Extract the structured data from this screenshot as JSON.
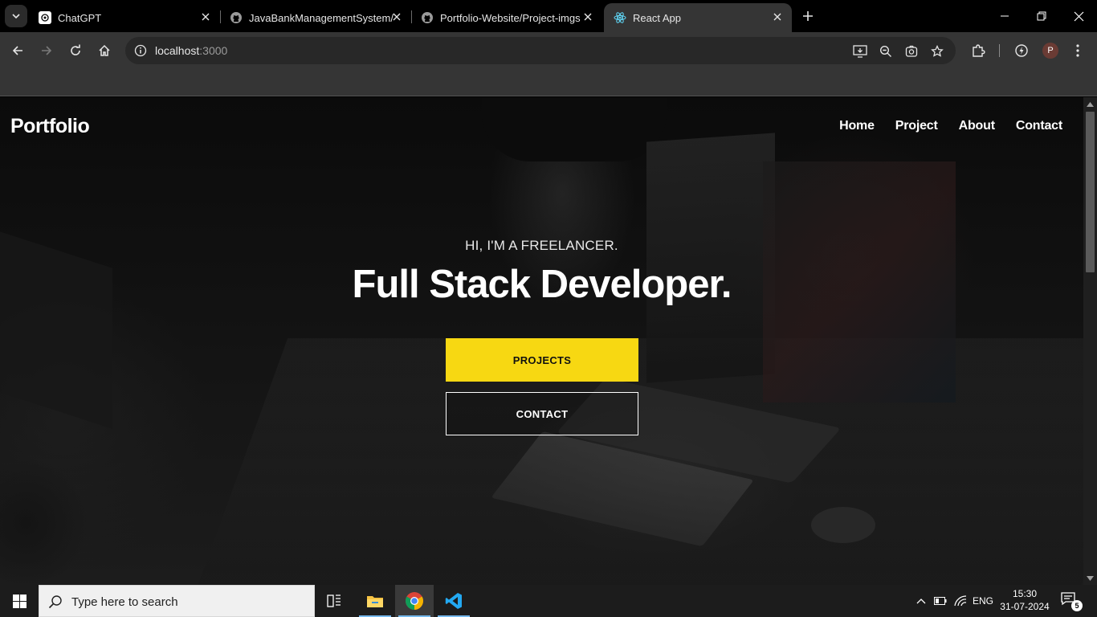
{
  "browser": {
    "tabs": [
      {
        "title": "ChatGPT",
        "favicon": "chatgpt-icon",
        "active": false
      },
      {
        "title": "JavaBankManagementSystem/R",
        "favicon": "github-icon",
        "active": false
      },
      {
        "title": "Portfolio-Website/Project-imgs",
        "favicon": "github-icon",
        "active": false
      },
      {
        "title": "React App",
        "favicon": "react-icon",
        "active": true
      }
    ],
    "url_host": "localhost",
    "url_port": ":3000",
    "profile_initial": "P"
  },
  "page": {
    "brand": "Portfolio",
    "nav": [
      "Home",
      "Project",
      "About",
      "Contact"
    ],
    "hero_subtitle": "HI, I'M A FREELANCER.",
    "hero_title": "Full Stack Developer.",
    "primary_button": "PROJECTS",
    "secondary_button": "CONTACT",
    "accent_color": "#f7d812"
  },
  "taskbar": {
    "search_placeholder": "Type here to search",
    "language": "ENG",
    "time": "15:30",
    "date": "31-07-2024",
    "notification_count": "5"
  }
}
